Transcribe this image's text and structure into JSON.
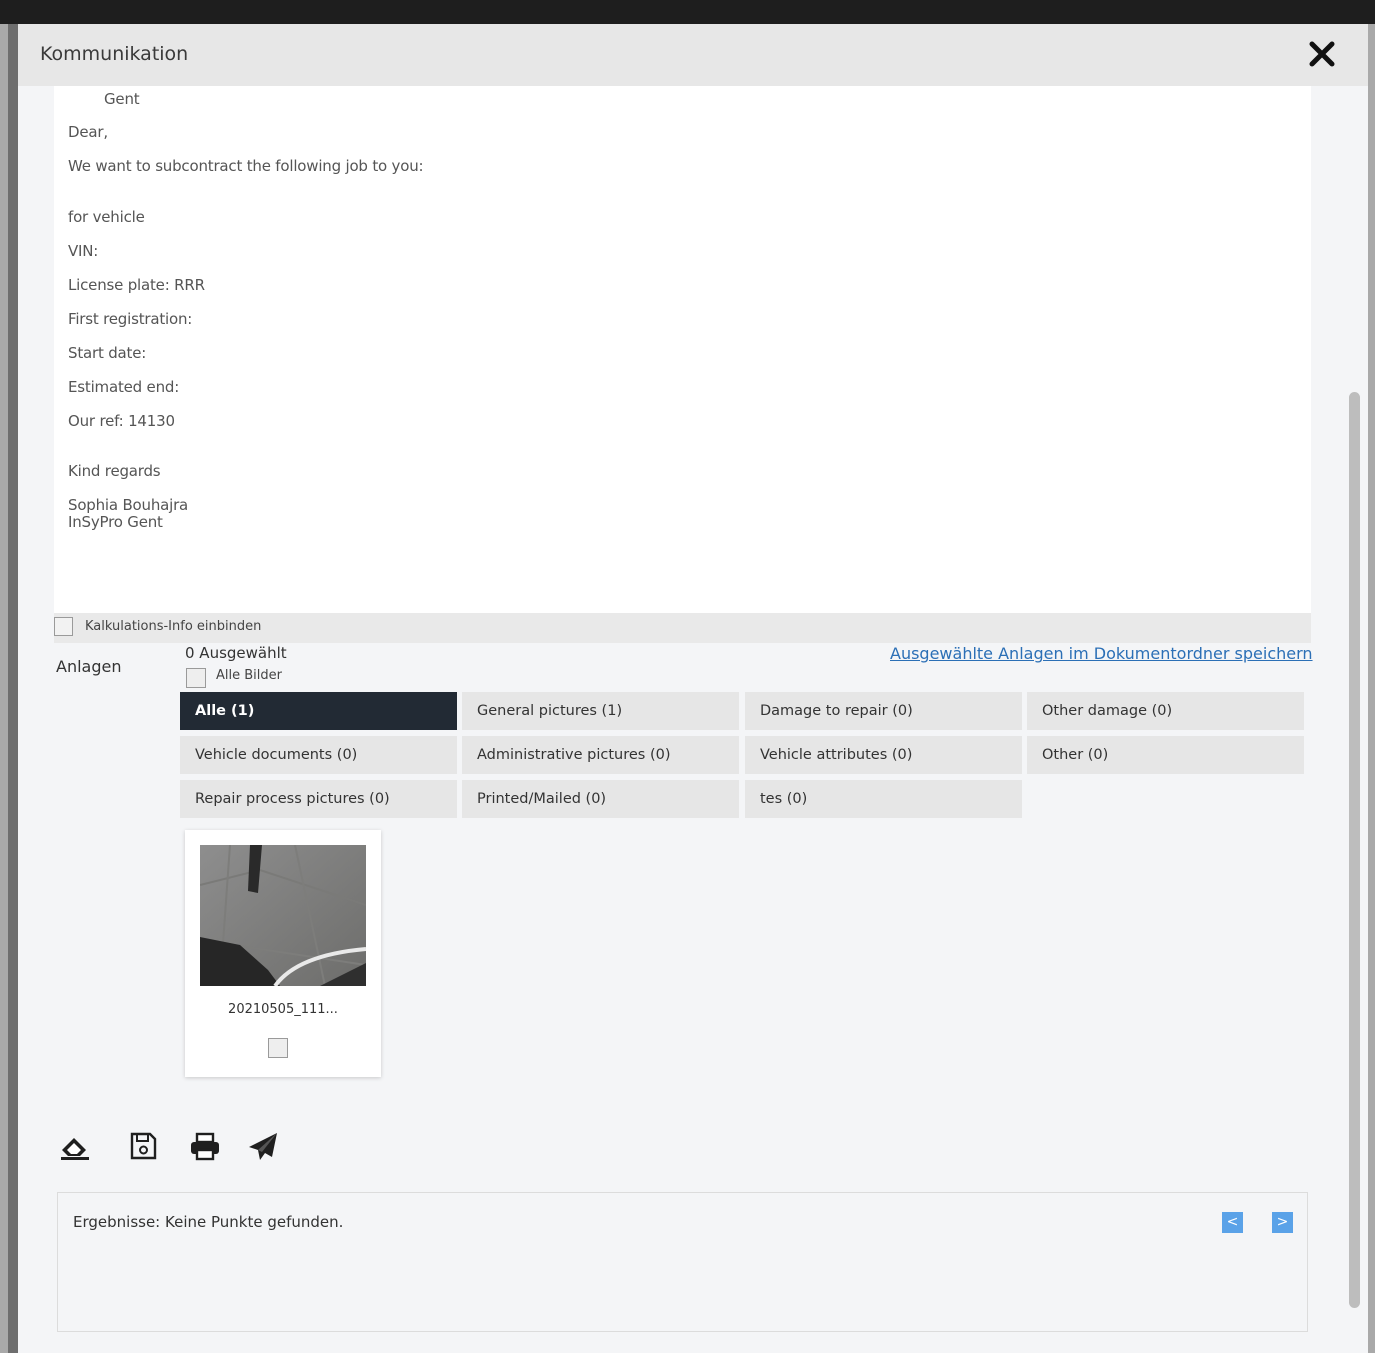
{
  "modal": {
    "title": "Kommunikation"
  },
  "editor": {
    "cutoff_line": "Gent",
    "lines": [
      "Dear,",
      "We want to subcontract the following job to you:",
      "for vehicle",
      "VIN:",
      "License plate: RRR",
      "First registration:",
      "Start date:",
      "Estimated end:",
      "Our ref: 14130",
      "Kind regards",
      "Sophia Bouhajra",
      "InSyPro  Gent"
    ]
  },
  "options": {
    "calc_info_label": "Kalkulations-Info einbinden"
  },
  "attachments": {
    "label": "Anlagen",
    "selected_count": "0 Ausgewählt",
    "all_pictures_label": "Alle Bilder",
    "save_link": "Ausgewählte Anlagen im Dokumentordner speichern",
    "tabs": [
      {
        "label": "Alle (1)",
        "active": true
      },
      {
        "label": "General pictures (1)"
      },
      {
        "label": "Damage to repair (0)"
      },
      {
        "label": "Other damage (0)"
      },
      {
        "label": "Vehicle documents (0)"
      },
      {
        "label": "Administrative pictures (0)"
      },
      {
        "label": "Vehicle attributes (0)"
      },
      {
        "label": "Other (0)"
      },
      {
        "label": "Repair process pictures (0)"
      },
      {
        "label": "Printed/Mailed (0)"
      },
      {
        "label": "tes (0)"
      }
    ],
    "items": [
      {
        "filename": "20210505_111..."
      }
    ]
  },
  "actions": {
    "icons": [
      "eraser-icon",
      "save-icon",
      "print-icon",
      "send-icon"
    ]
  },
  "results": {
    "text": "Ergebnisse: Keine Punkte gefunden.",
    "prev_glyph": "<",
    "next_glyph": ">"
  },
  "colors": {
    "active_tab": "#222a34",
    "link": "#2b6fb6",
    "pager": "#5aa2e8"
  }
}
